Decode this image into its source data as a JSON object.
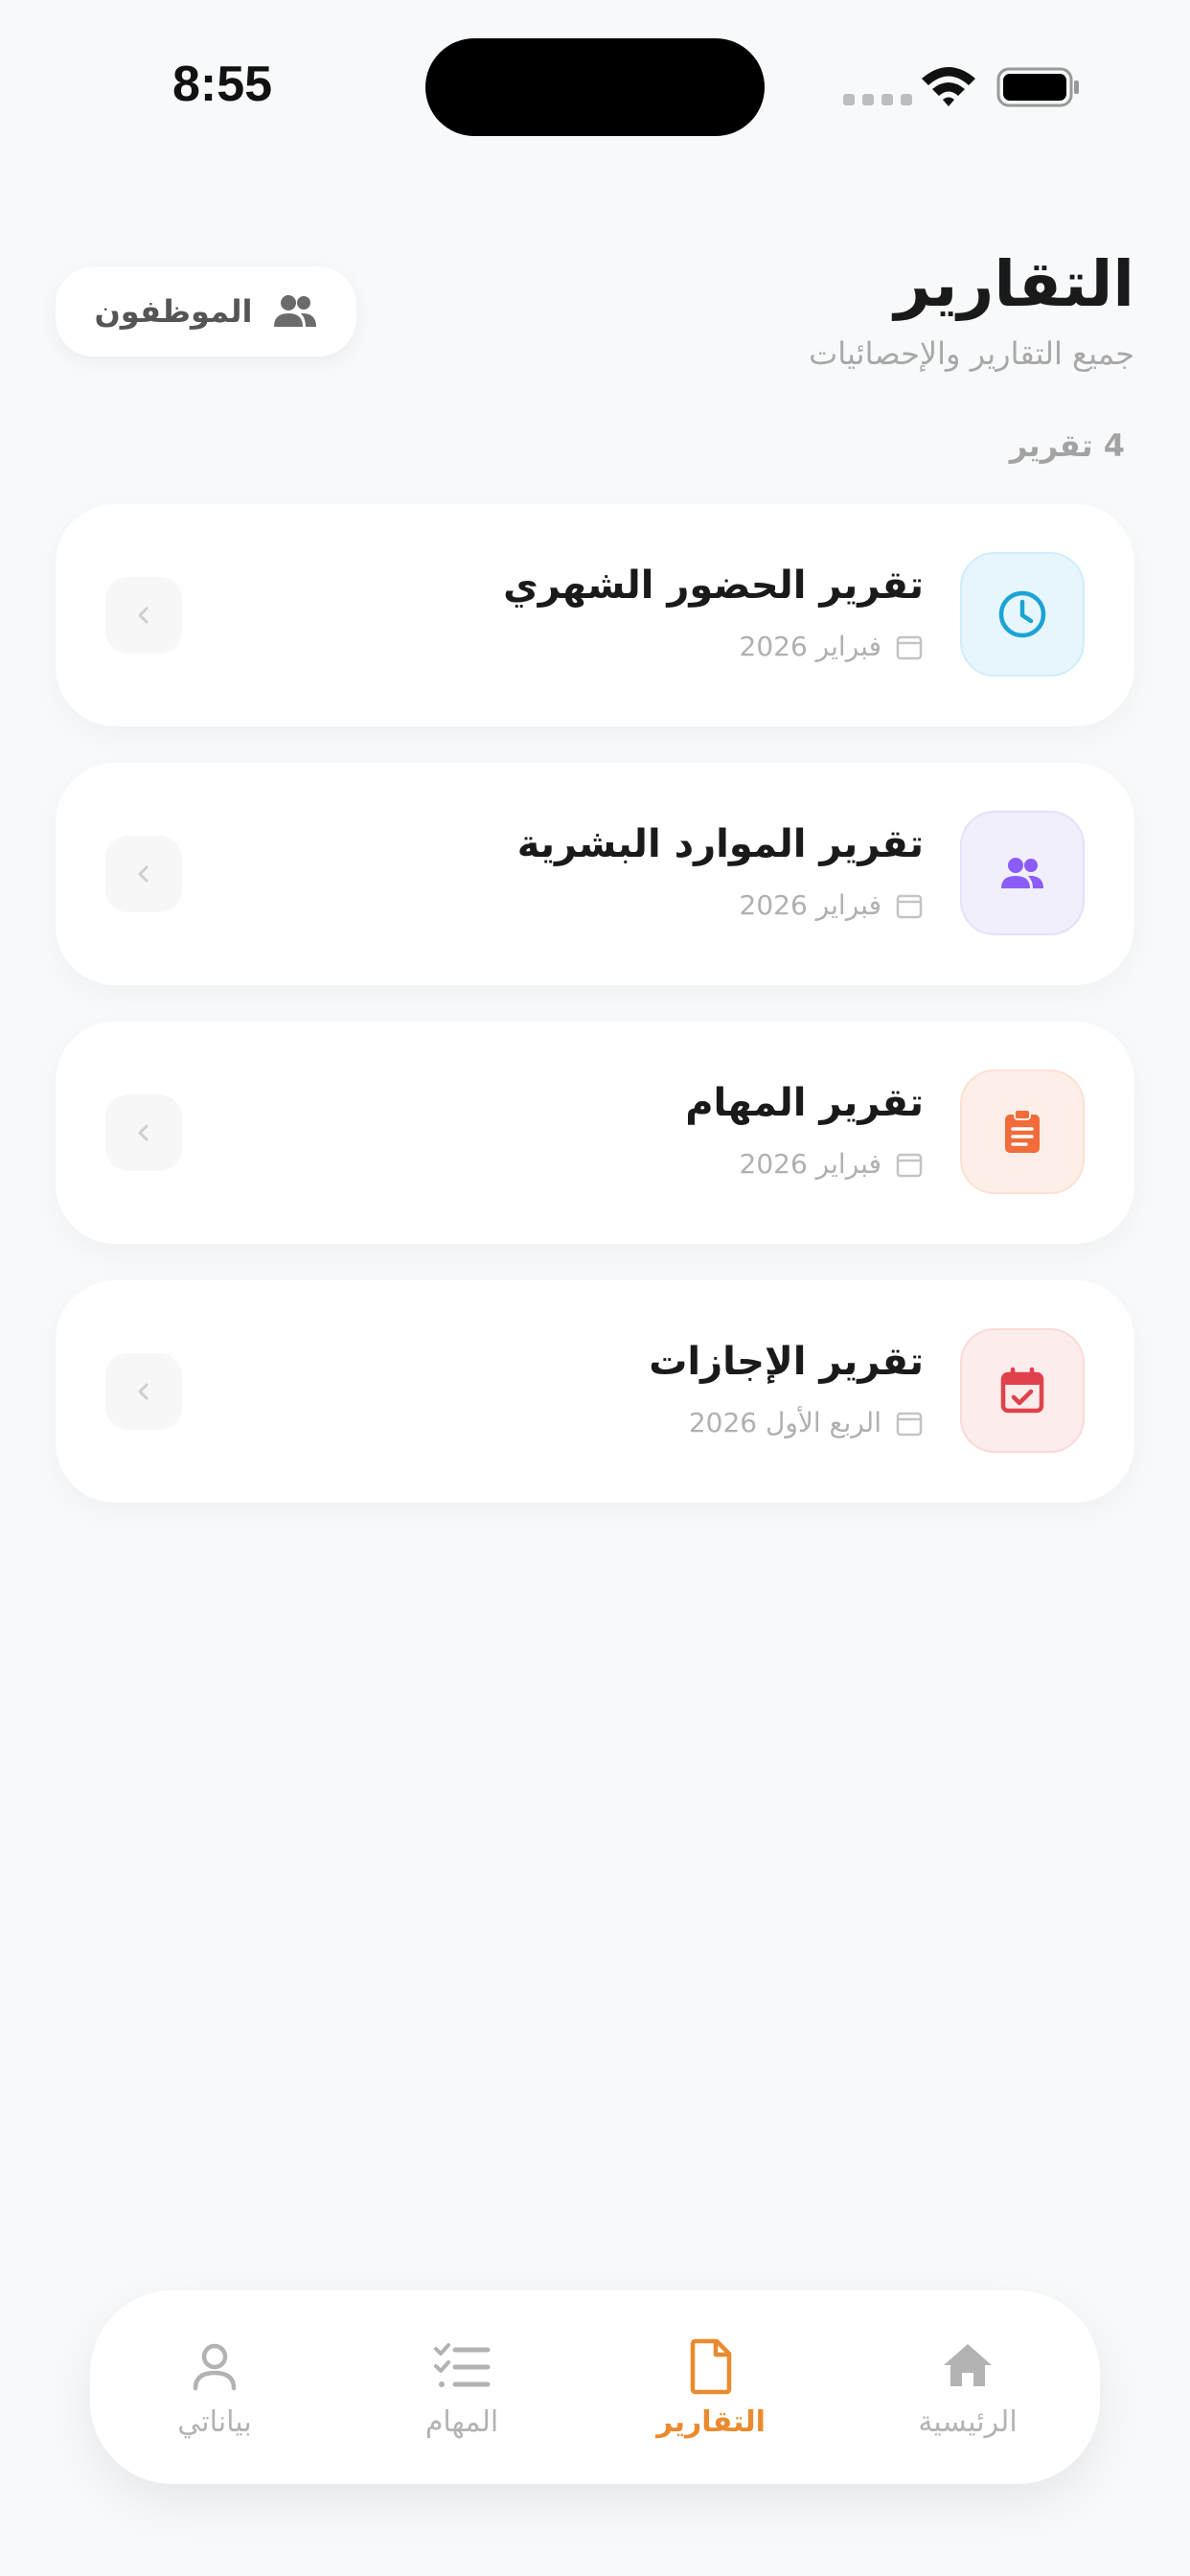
{
  "status_bar": {
    "time": "8:55"
  },
  "header": {
    "title": "التقارير",
    "subtitle": "جميع التقارير والإحصائيات",
    "employees_button_label": "الموظفون"
  },
  "count_label": "4 تقرير",
  "reports": [
    {
      "title": "تقرير الحضور الشهري",
      "date": "فبراير 2026",
      "icon": "clock-icon",
      "icon_bg": "#e7f6fc",
      "icon_color": "#1aa3d6"
    },
    {
      "title": "تقرير الموارد البشرية",
      "date": "فبراير 2026",
      "icon": "users-icon",
      "icon_bg": "#f2effd",
      "icon_color": "#8b5cf6"
    },
    {
      "title": "تقرير المهام",
      "date": "فبراير 2026",
      "icon": "clipboard-icon",
      "icon_bg": "#fdefe8",
      "icon_color": "#f26b3a"
    },
    {
      "title": "تقرير الإجازات",
      "date": "الربع الأول 2026",
      "icon": "calendar-check-icon",
      "icon_bg": "#fdecec",
      "icon_color": "#e0414a"
    }
  ],
  "tab_bar": {
    "items": [
      {
        "label": "الرئيسية",
        "icon": "home-icon",
        "active": false
      },
      {
        "label": "التقارير",
        "icon": "document-icon",
        "active": true
      },
      {
        "label": "المهام",
        "icon": "checklist-icon",
        "active": false
      },
      {
        "label": "بياناتي",
        "icon": "user-icon",
        "active": false
      }
    ],
    "accent_color": "#ea8a2e",
    "inactive_color": "#b3b3b3"
  }
}
